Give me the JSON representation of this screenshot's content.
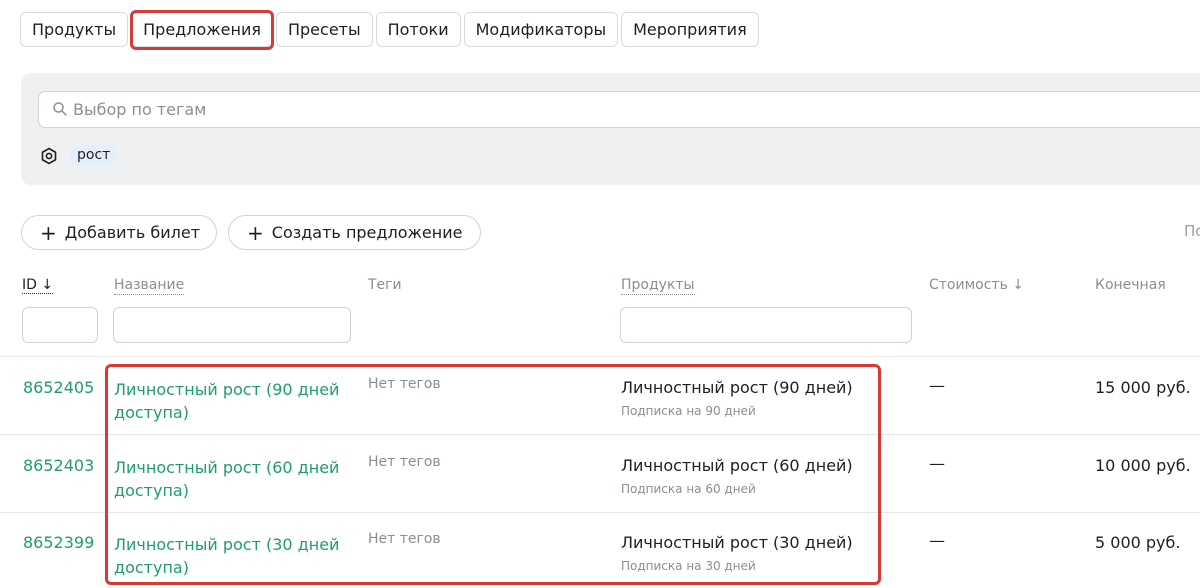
{
  "tabs": [
    {
      "label": "Продукты"
    },
    {
      "label": "Предложения"
    },
    {
      "label": "Пресеты"
    },
    {
      "label": "Потоки"
    },
    {
      "label": "Модификаторы"
    },
    {
      "label": "Мероприятия"
    }
  ],
  "active_tab": "Предложения",
  "filter": {
    "search_placeholder": "Выбор по тегам",
    "tags": [
      "рост"
    ]
  },
  "actions": {
    "add_ticket": "Добавить билет",
    "create_offer": "Создать предложение",
    "edge_text": "По"
  },
  "columns": {
    "id": "ID",
    "name": "Название",
    "tags": "Теги",
    "products": "Продукты",
    "cost": "Стоимость",
    "final": "Конечная"
  },
  "rows": [
    {
      "id": "8652405",
      "name": "Личностный рост (90 дней доступа)",
      "tags": "Нет тегов",
      "product": "Личностный рост (90 дней)",
      "product_sub": "Подписка на 90 дней",
      "cost": "—",
      "final": "15 000 руб."
    },
    {
      "id": "8652403",
      "name": "Личностный рост (60 дней доступа)",
      "tags": "Нет тегов",
      "product": "Личностный рост (60 дней)",
      "product_sub": "Подписка на 60 дней",
      "cost": "—",
      "final": "10 000 руб."
    },
    {
      "id": "8652399",
      "name": "Личностный рост (30 дней доступа)",
      "tags": "Нет тегов",
      "product": "Личностный рост (30 дней)",
      "product_sub": "Подписка на 30 дней",
      "cost": "—",
      "final": "5 000 руб."
    }
  ],
  "colors": {
    "accent_green": "#1f9e6a",
    "highlight_red": "#d63b36",
    "panel_bg": "#eef0f2"
  },
  "icons": {
    "search": "search-icon",
    "tag_filter": "tag-filter-icon",
    "sort": "arrow-down-icon",
    "add": "plus-icon"
  }
}
